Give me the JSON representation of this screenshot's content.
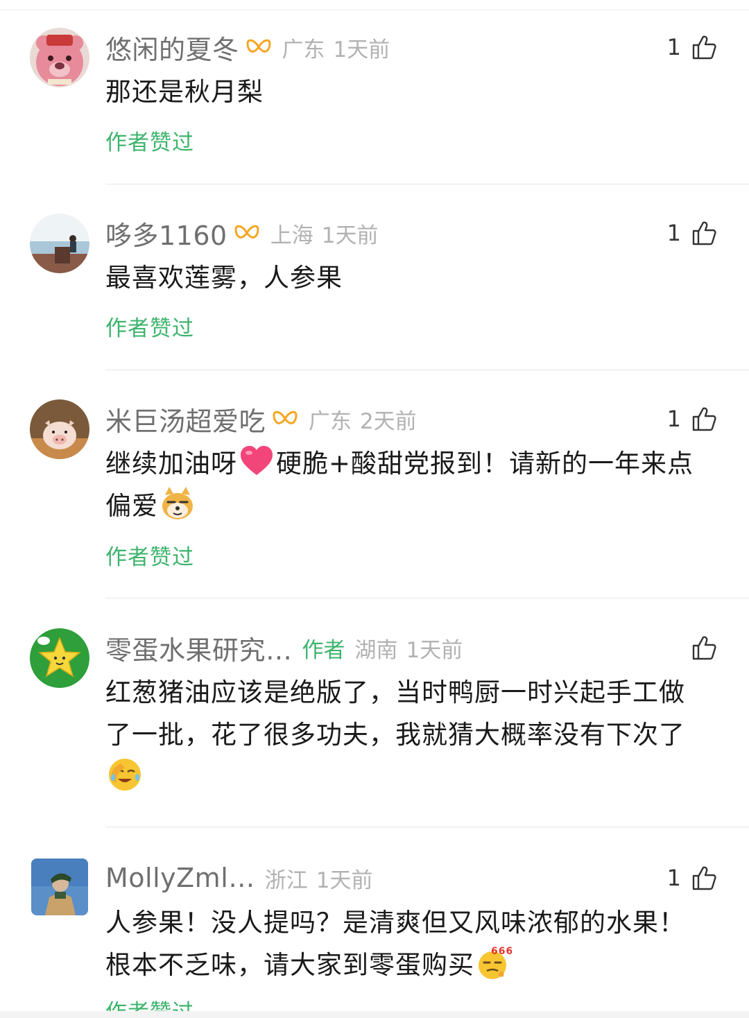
{
  "comments": [
    {
      "name": "悠闲的夏冬",
      "region": "广东",
      "time": "1天前",
      "likes": "1",
      "lines": [
        "那还是秋月梨"
      ],
      "author_liked": "作者赞过"
    },
    {
      "name": "哆多1160",
      "region": "上海",
      "time": "1天前",
      "likes": "1",
      "lines": [
        "最喜欢莲雾，人参果"
      ],
      "author_liked": "作者赞过"
    },
    {
      "name": "米巨汤超爱吃",
      "region": "广东",
      "time": "2天前",
      "likes": "1",
      "text_a": "继续加油呀",
      "text_b": "硬脆+酸甜党报到！请新的一年来点",
      "text_c": "偏爱",
      "author_liked": "作者赞过"
    },
    {
      "name": "零蛋水果研究…",
      "author_tag": "作者",
      "region": "湖南",
      "time": "1天前",
      "likes": "",
      "lines": [
        "红葱猪油应该是绝版了，当时鸭厨一时兴起手工做",
        "了一批，花了很多功夫，我就猜大概率没有下次了"
      ]
    },
    {
      "name": "MollyZml…",
      "region": "浙江",
      "time": "1天前",
      "likes": "1",
      "lines": [
        "人参果！没人提吗？是清爽但又风味浓郁的水果！",
        "根本不乏味，请大家到零蛋购买"
      ],
      "author_liked": "作者赞过"
    }
  ],
  "icons": {
    "fans_badge": "fans-badge-icon",
    "like": "thumb-up-icon",
    "accent_green": "#3db46d",
    "fans_badge_color": "#f5a623"
  }
}
